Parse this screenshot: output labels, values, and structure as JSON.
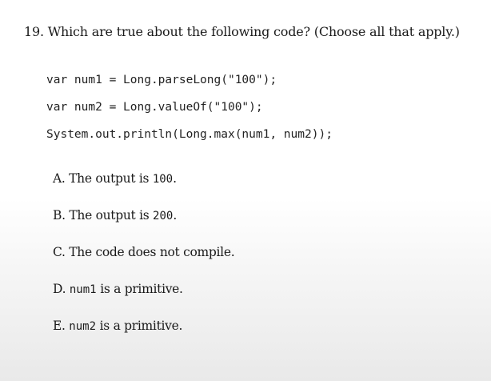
{
  "question": {
    "text": "19. Which are true about the following code? (Choose all that apply.)"
  },
  "code": {
    "lines": [
      "var num1 = Long.parseLong(\"100\");",
      "var num2 = Long.valueOf(\"100\");",
      "System.out.println(Long.max(num1, num2));"
    ]
  },
  "options": [
    {
      "prefix": "A. The output is ",
      "code": "100",
      "suffix": "."
    },
    {
      "prefix": "B. The output is ",
      "code": "200",
      "suffix": "."
    },
    {
      "prefix": "C. The code does not compile.",
      "code": "",
      "suffix": ""
    },
    {
      "prefix": "D. ",
      "code": "num1",
      "suffix": " is a primitive."
    },
    {
      "prefix": "E. ",
      "code": "num2",
      "suffix": " is a primitive."
    }
  ]
}
